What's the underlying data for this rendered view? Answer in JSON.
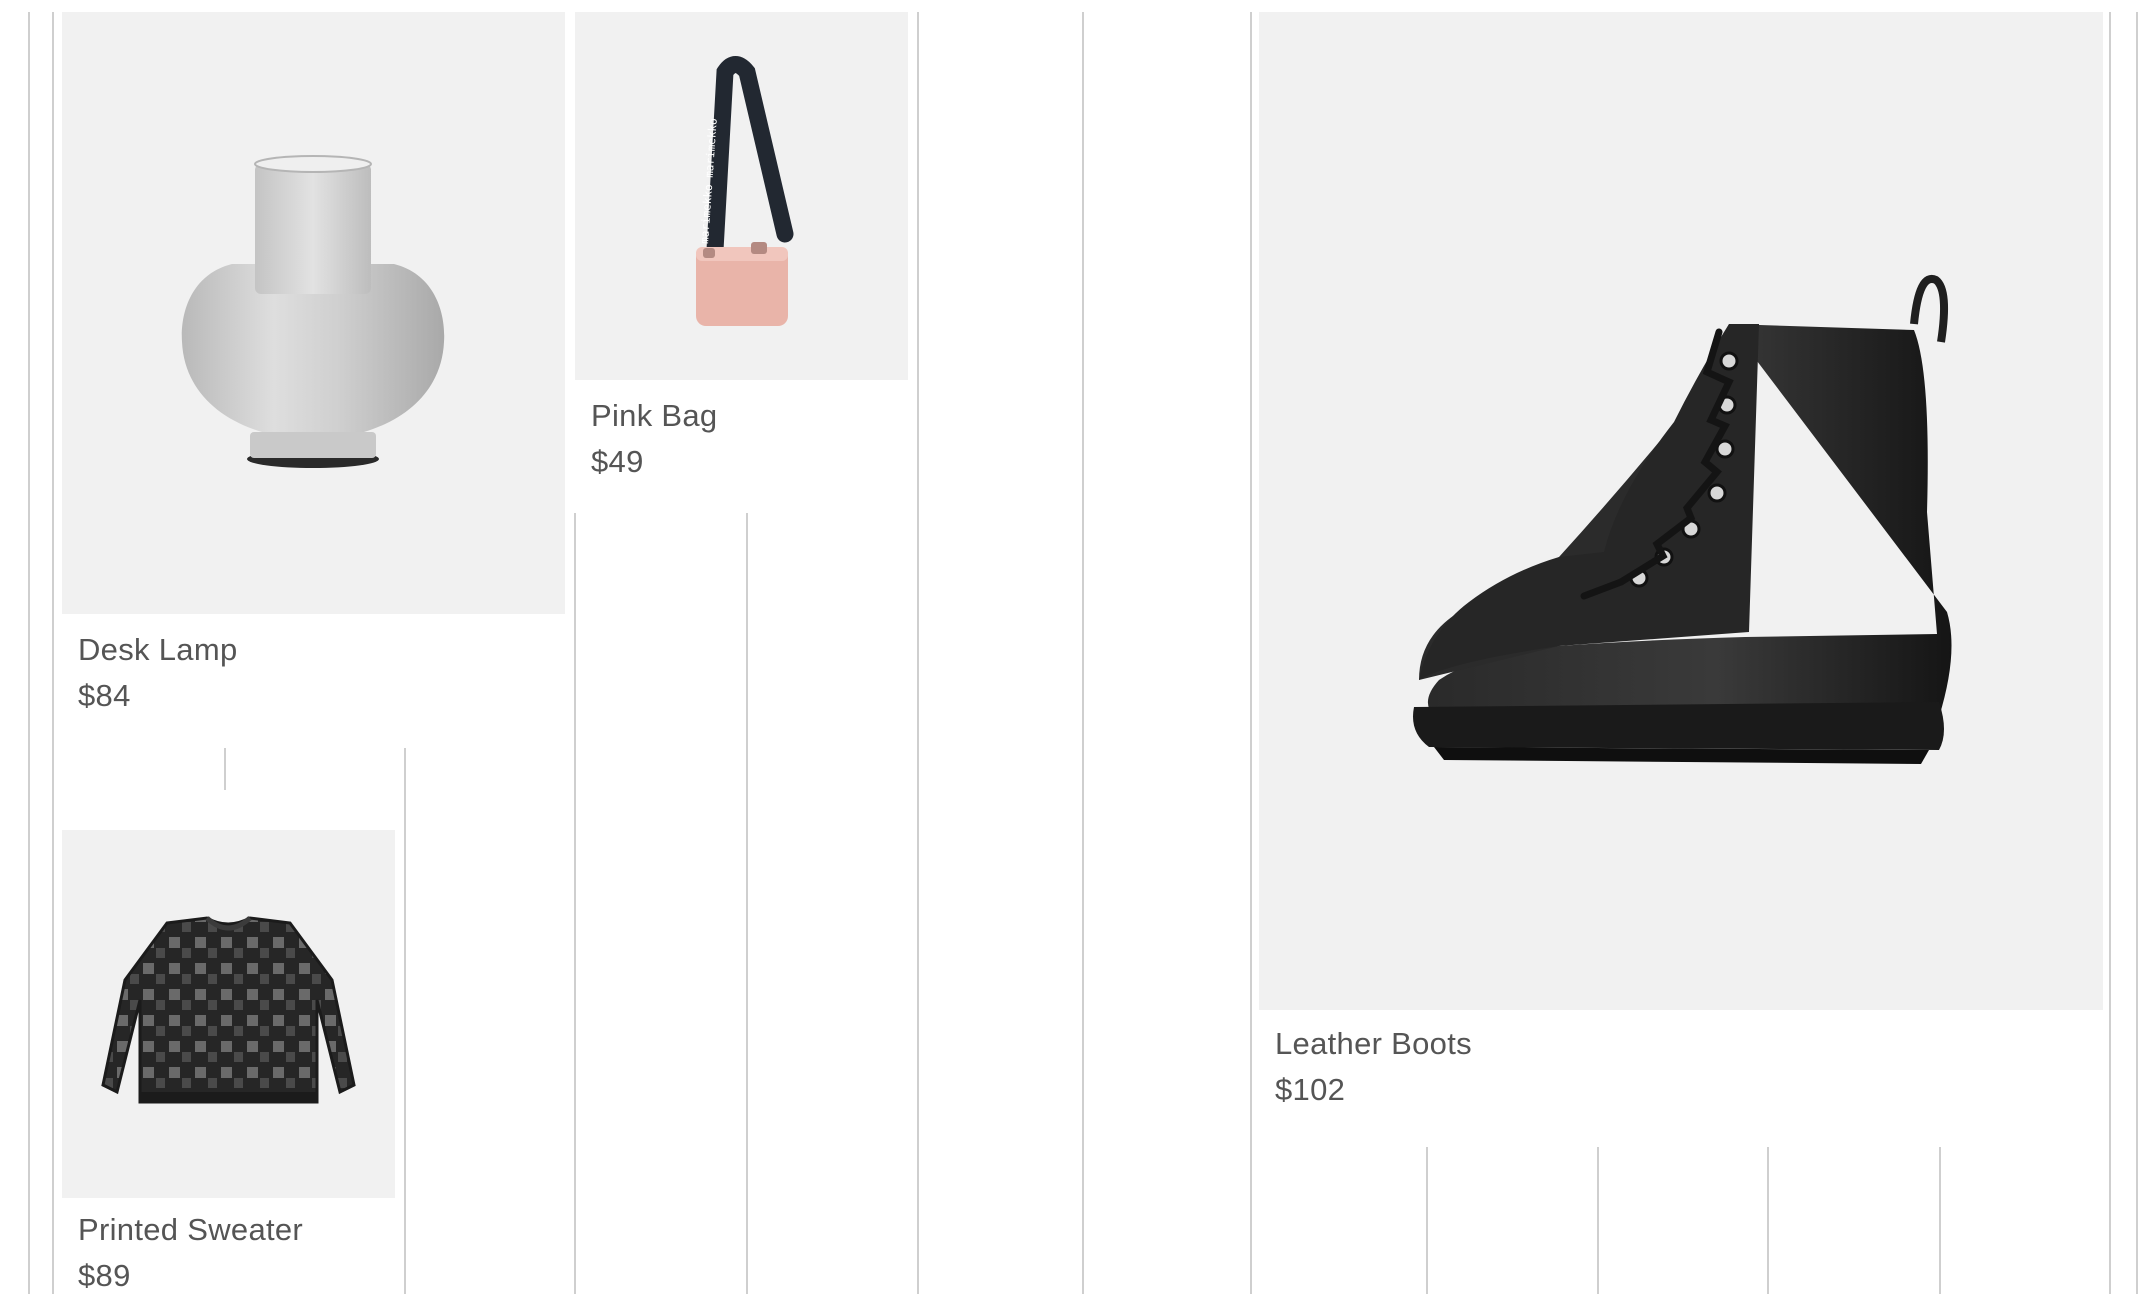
{
  "grid": {
    "products": [
      {
        "id": "desk-lamp",
        "name": "Desk Lamp",
        "price": "$84",
        "image": "vase-shaped-glass-lamp-icon"
      },
      {
        "id": "pink-bag",
        "name": "Pink Bag",
        "price": "$49",
        "image": "pink-crossbody-bag-icon"
      },
      {
        "id": "leather-boots",
        "name": "Leather Boots",
        "price": "$102",
        "image": "black-leather-boot-icon"
      },
      {
        "id": "printed-sweater",
        "name": "Printed Sweater",
        "price": "$89",
        "image": "checkered-sweater-icon"
      }
    ],
    "bag_strap_text": "marimekko marimekko"
  },
  "colors": {
    "card_background": "#f1f1f1",
    "text": "#555555",
    "divider": "#cfcfcf",
    "bag_pink": "#e9b4a9",
    "boot_black": "#1f1f1f"
  }
}
